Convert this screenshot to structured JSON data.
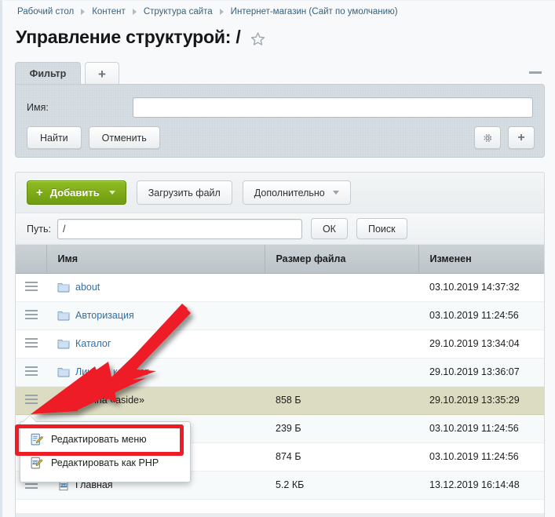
{
  "breadcrumb": {
    "items": [
      {
        "label": "Рабочий стол"
      },
      {
        "label": "Контент"
      },
      {
        "label": "Структура сайта"
      },
      {
        "label": "Интернет-магазин (Сайт по умолчанию)"
      }
    ]
  },
  "header": {
    "title": "Управление структурой: /",
    "favorite_icon": "star-icon"
  },
  "filter": {
    "tab_label": "Фильтр",
    "add_tab_label": "+",
    "collapse_label": "",
    "name_label": "Имя:",
    "name_value": "",
    "name_placeholder": "",
    "search_button": "Найти",
    "cancel_button": "Отменить",
    "settings_icon": "gear-icon",
    "add_icon": "plus-icon"
  },
  "toolbar": {
    "add_label": "Добавить",
    "upload_label": "Загрузить файл",
    "more_label": "Дополнительно",
    "add_color": "#7ba817"
  },
  "pathbar": {
    "label": "Путь:",
    "value": "/",
    "ok_label": "ОК",
    "search_label": "Поиск"
  },
  "table": {
    "columns": [
      {
        "key": "handle",
        "label": ""
      },
      {
        "key": "name",
        "label": "Имя"
      },
      {
        "key": "size",
        "label": "Размер файла"
      },
      {
        "key": "date",
        "label": "Изменен"
      }
    ],
    "rows": [
      {
        "icon": "folder-icon",
        "name": "about",
        "is_link": true,
        "size": "",
        "date": "03.10.2019 14:37:32",
        "selected": false
      },
      {
        "icon": "folder-icon",
        "name": "Авторизация",
        "is_link": true,
        "size": "",
        "date": "03.10.2019 11:24:56",
        "selected": false
      },
      {
        "icon": "folder-icon",
        "name": "Каталог",
        "is_link": true,
        "size": "",
        "date": "29.10.2019 13:34:04",
        "selected": false
      },
      {
        "icon": "folder-icon",
        "name": "Личный кабинет",
        "is_link": true,
        "size": "",
        "date": "29.10.2019 13:36:07",
        "selected": false
      },
      {
        "icon": "",
        "name": "Меню типа «aside»",
        "is_link": false,
        "size": "858 Б",
        "date": "29.10.2019 13:35:29",
        "selected": true
      },
      {
        "icon": "",
        "name": "",
        "is_link": false,
        "size": "239 Б",
        "date": "03.10.2019 11:24:56",
        "selected": false
      },
      {
        "icon": "",
        "name": "",
        "is_link": false,
        "size": "874 Б",
        "date": "03.10.2019 11:24:56",
        "selected": false
      },
      {
        "icon": "php-icon",
        "name": "Главная",
        "is_link": false,
        "size": "5.2 КБ",
        "date": "13.12.2019 16:14:48",
        "selected": false
      }
    ]
  },
  "context_menu": {
    "items": [
      {
        "icon": "edit-menu-icon",
        "label": "Редактировать меню",
        "highlighted": true
      },
      {
        "icon": "edit-php-icon",
        "label": "Редактировать как PHP",
        "highlighted": false
      }
    ],
    "highlight_color": "#ee1c25"
  },
  "annotation": {
    "arrow_color": "#ee1c25"
  }
}
